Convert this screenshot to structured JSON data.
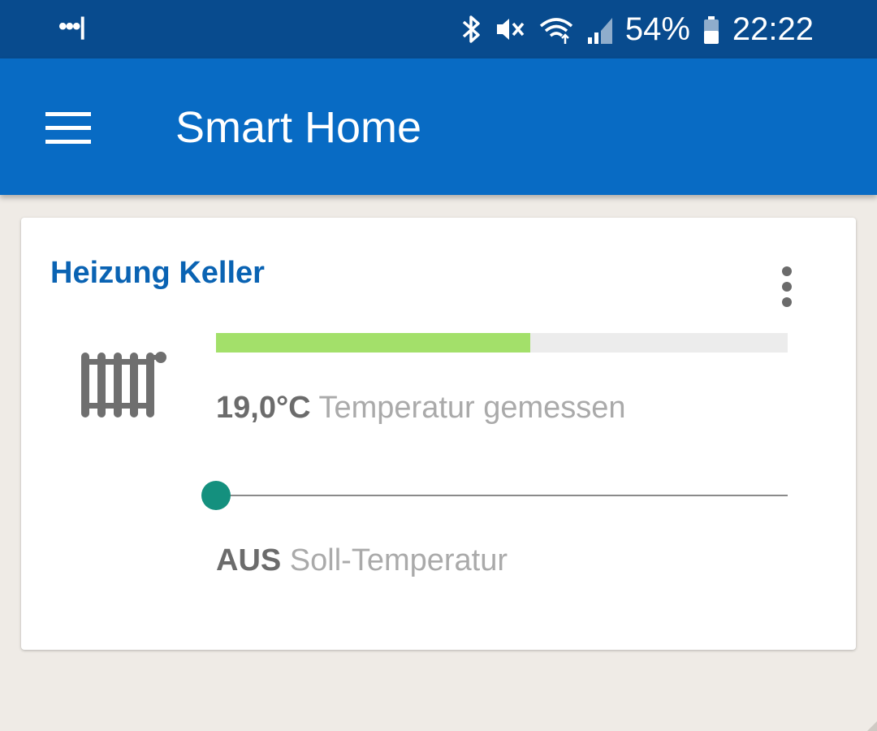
{
  "status_bar": {
    "notification_dots": "•••|",
    "battery_percent": "54%",
    "time": "22:22",
    "icons": [
      "bluetooth-icon",
      "vibrate-mute-icon",
      "wifi-icon",
      "signal-icon",
      "battery-icon"
    ]
  },
  "app_bar": {
    "title": "Smart Home",
    "menu_icon": "hamburger-menu-icon",
    "color": "#086bc4"
  },
  "device_card": {
    "title": "Heizung Keller",
    "icon": "radiator-icon",
    "overflow_icon": "more-vert-icon",
    "measured": {
      "value": "19,0°C",
      "label": "Temperatur gemessen",
      "bar_fraction": 0.55,
      "bar_color": "#a3e06a"
    },
    "setpoint": {
      "value": "AUS",
      "label": "Soll-Temperatur",
      "slider_fraction": 0.0,
      "thumb_color": "#14907e"
    }
  },
  "colors": {
    "status_bar": "#084b8e",
    "title_blue": "#0a63b3",
    "background": "#efebe6"
  }
}
